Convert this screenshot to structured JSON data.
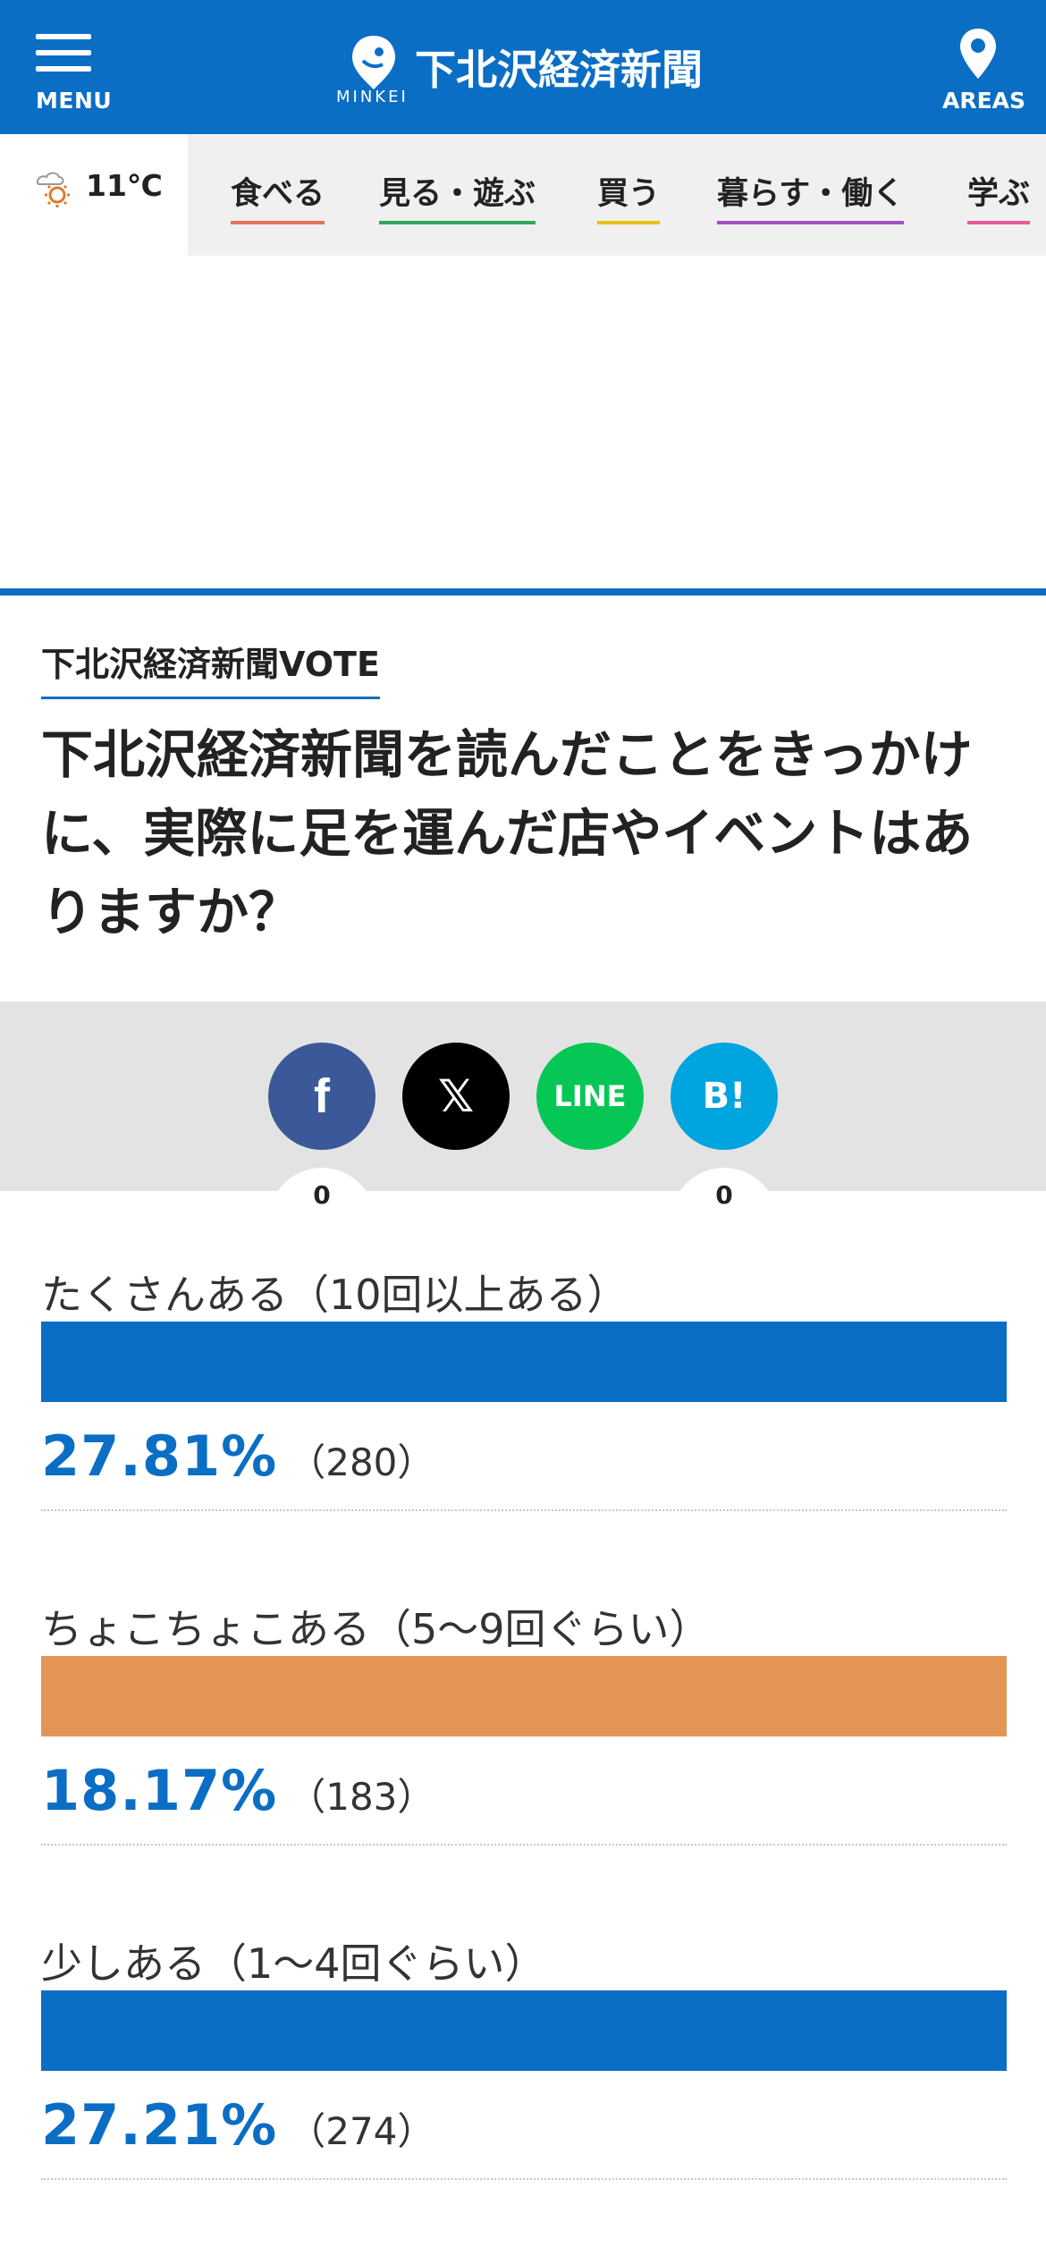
{
  "header": {
    "menu_label": "MENU",
    "logo_title": "下北沢経済新聞",
    "logo_sub": "MINKEI",
    "areas_label": "AREAS",
    "color": "#0b6ec5"
  },
  "weather": {
    "temp": "11℃",
    "icon": "cloud-sun-icon"
  },
  "categories": [
    {
      "label": "食べる",
      "color": "#e8735a"
    },
    {
      "label": "見る・遊ぶ",
      "color": "#2ea85a"
    },
    {
      "label": "買う",
      "color": "#e8c21a"
    },
    {
      "label": "暮らす・働く",
      "color": "#a44fc8"
    },
    {
      "label": "学ぶ",
      "color": "#e85a9a"
    }
  ],
  "vote": {
    "section_label": "下北沢経済新聞VOTE",
    "question": "下北沢経済新聞を読んだことをきっかけに、実際に足を運んだ店やイベントはありますか？"
  },
  "share": {
    "facebook": {
      "label": "f",
      "count": "0",
      "color": "#3b5998"
    },
    "x": {
      "label": "𝕏",
      "color": "#000000"
    },
    "line": {
      "label": "LINE",
      "color": "#06c755"
    },
    "hatena": {
      "label": "B!",
      "count": "0",
      "color": "#00a4de"
    }
  },
  "results": [
    {
      "label": "たくさんある（10回以上ある）",
      "percent": "27.81%",
      "count": "（280）",
      "color": "#0b6ec5"
    },
    {
      "label": "ちょこちょこある（5〜9回ぐらい）",
      "percent": "18.17%",
      "count": "（183）",
      "color": "#e49555"
    },
    {
      "label": "少しある（1〜4回ぐらい）",
      "percent": "27.21%",
      "count": "（274）",
      "color": "#0b6ec5"
    }
  ]
}
